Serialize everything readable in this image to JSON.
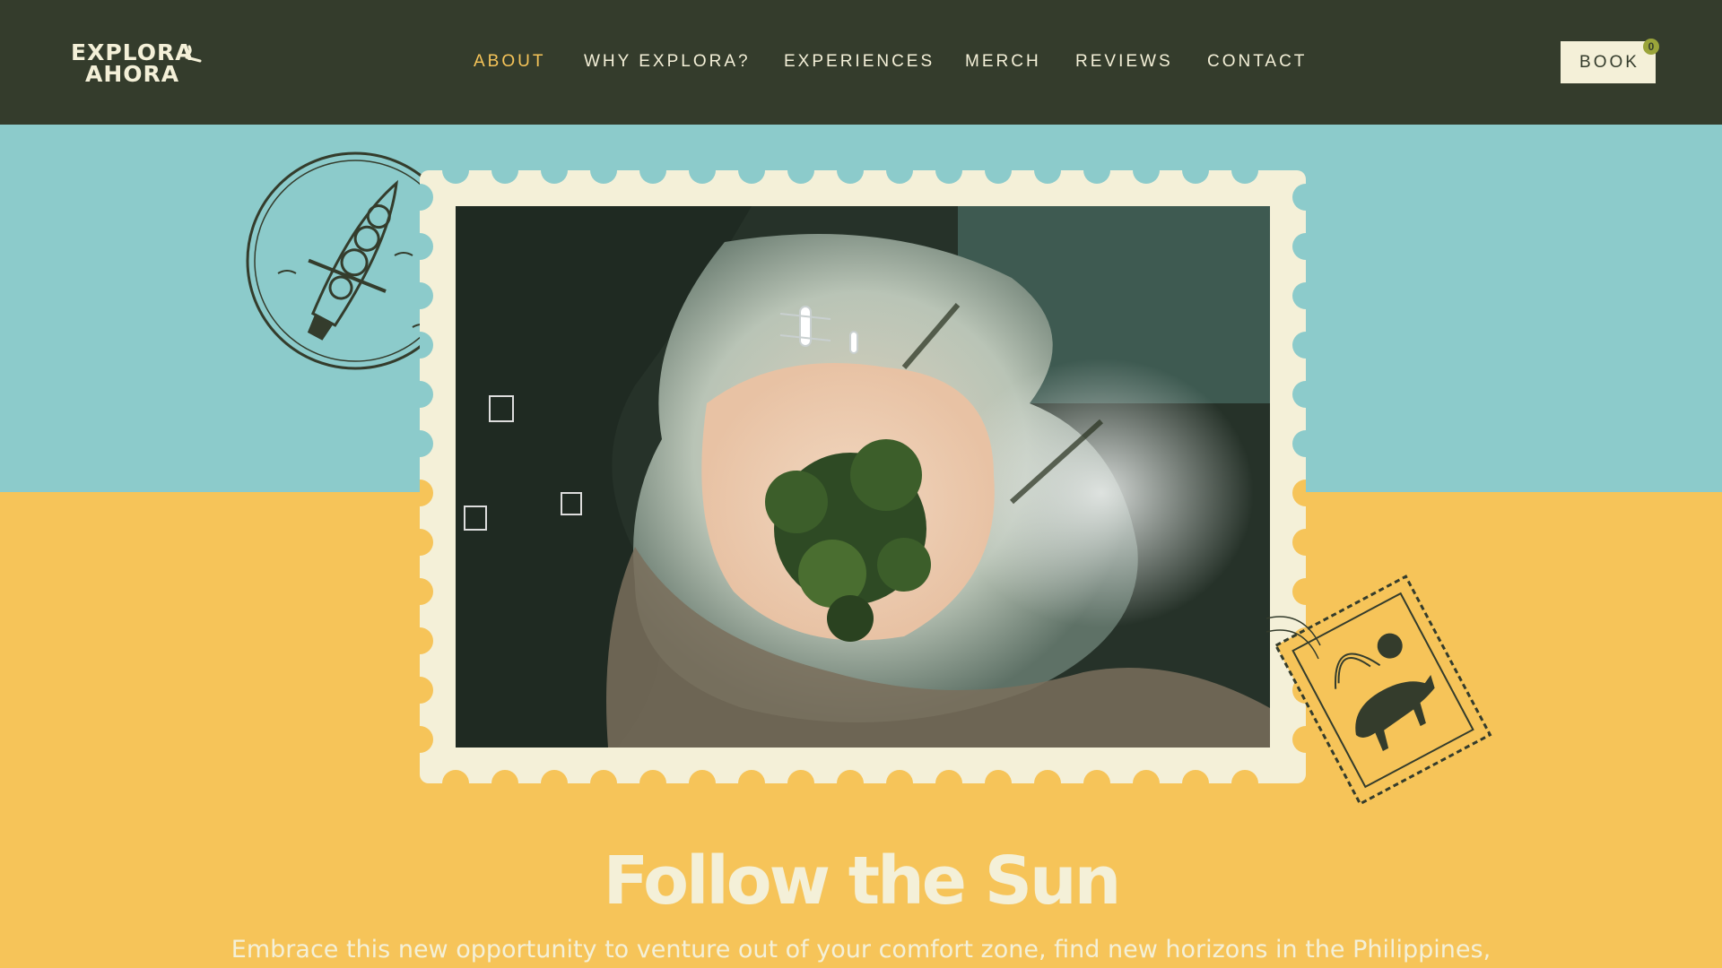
{
  "brand": {
    "logo_line1": "EXPLORA",
    "logo_line2": "AHORA"
  },
  "nav": {
    "items": [
      {
        "label": "ABOUT",
        "active": true
      },
      {
        "label": "WHY EXPLORA?",
        "active": false
      },
      {
        "label": "EXPERIENCES",
        "active": false
      },
      {
        "label": "MERCH",
        "active": false
      },
      {
        "label": "REVIEWS",
        "active": false
      },
      {
        "label": "CONTACT",
        "active": false
      }
    ],
    "book_label": "BOOK",
    "cart_count": "0"
  },
  "hero": {
    "headline": "Follow the Sun",
    "subtext": "Embrace this new opportunity to venture out of your comfort zone, find new horizons in the Philippines,"
  },
  "icons": {
    "logo": "sun-mark-icon",
    "left_stamp": "bangka-boat-stamp-icon",
    "right_stamp": "carabao-stamp-icon"
  },
  "colors": {
    "nav_bg": "#343c2c",
    "accent_yellow": "#f6c459",
    "sky_teal": "#8ccbcb",
    "cream": "#f4f0d8",
    "badge_green": "#9aa43a"
  }
}
